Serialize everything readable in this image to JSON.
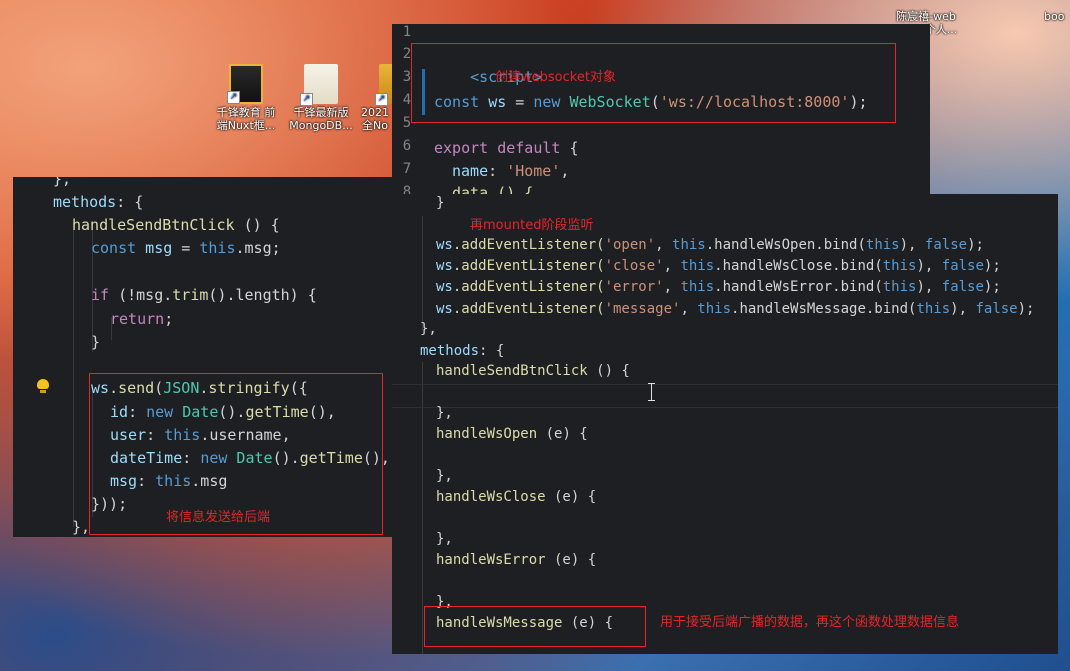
{
  "desktop": {
    "icons": [
      {
        "label": "千锋教育 前端Nuxt框...",
        "label1": "千锋教育 前",
        "label2": "端Nuxt框..."
      },
      {
        "label": "千锋最新版 MongoDB...",
        "label1": "千锋最新版",
        "label2": "MongoDB..."
      },
      {
        "label1": "2021",
        "label2": "全No"
      },
      {
        "label1": "陈宸禧-web",
        "label2": "个人..."
      },
      {
        "label1": "boo",
        "label2": ""
      }
    ]
  },
  "editor_top": {
    "line_numbers": [
      "1",
      "2",
      "3",
      "4",
      "5",
      "6",
      "7",
      "8"
    ],
    "lines": {
      "l2_tag": "<script>",
      "l4_const": "const",
      "l4_ws": "ws",
      "l4_eq": " = ",
      "l4_new": "new",
      "l4_cls": "WebSocket",
      "l4_open": "(",
      "l4_str": "'ws://localhost:8000'",
      "l4_close": ");",
      "l6_export": "export default",
      "l6_brace": " {",
      "l7_key": "name",
      "l7_colon": ": ",
      "l7_val": "'Home'",
      "l7_comma": ",",
      "l8_data": "data () {"
    },
    "note": "创建websocket对象"
  },
  "editor_left": {
    "lines": {
      "c0": "},",
      "c1_key": "methods",
      "c1_rest": ": {",
      "c2_fn": "handleSendBtnClick",
      "c2_rest": " () {",
      "c3_const": "const",
      "c3_var": " msg",
      "c3_eq": " = ",
      "c3_this": "this",
      "c3_rest": ".msg;",
      "c5_if": "if",
      "c5_a": " (!msg.",
      "c5_trim": "trim",
      "c5_b": "().length) {",
      "c6_ret": "return",
      "c6_semi": ";",
      "c7": "}",
      "c9_ws": "ws",
      "c9_dot": ".",
      "c9_send": "send",
      "c9_p": "(",
      "c9_json": "JSON",
      "c9_dot2": ".",
      "c9_str": "stringify",
      "c9_b": "({",
      "c10_key": "id",
      "c10_colon": ": ",
      "c10_new": "new",
      "c10_cls": " Date",
      "c10_rest": "().",
      "c10_fn": "getTime",
      "c10_end": "(),",
      "c11_key": "user",
      "c11_colon": ": ",
      "c11_this": "this",
      "c11_rest": ".username,",
      "c12_key": "dateTime",
      "c12_colon": ": ",
      "c12_new": "new",
      "c12_cls": " Date",
      "c12_rest": "().",
      "c12_fn": "getTime",
      "c12_end": "(),",
      "c13_key": "msg",
      "c13_colon": ": ",
      "c13_this": "this",
      "c13_rest": ".msg",
      "c14": "}));",
      "c15": "},"
    },
    "note": "将信息发送给后端"
  },
  "editor_right": {
    "lines": {
      "r0": "}",
      "r1_ws": "ws",
      "r1_m": ".addEventListener(",
      "r1_s": "'open'",
      "r1_c": ", ",
      "r1_this": "this",
      "r1_h": ".handleWsOpen.bind(",
      "r1_this2": "this",
      "r1_e": "), ",
      "r1_f": "false",
      "r1_end": ");",
      "r2_s": "'close'",
      "r2_h": ".handleWsClose.bind(",
      "r3_s": "'error'",
      "r3_h": ".handleWsError.bind(",
      "r4_s": "'message'",
      "r4_h": ".handleWsMessage.bind(",
      "r5": "},",
      "r6_key": "methods",
      "r6_rest": ": {",
      "r7_fn": "handleSendBtnClick",
      "r7_rest": " () {",
      "r9": "},",
      "r10_fn": "handleWsOpen",
      "r10_rest": " (e) {",
      "r11": "},",
      "r12_fn": "handleWsClose",
      "r12_rest": " (e) {",
      "r13": "},",
      "r14_fn": "handleWsError",
      "r14_rest": " (e) {",
      "r15": "},",
      "r16_fn": "handleWsMessage",
      "r16_rest": " (e) {"
    },
    "note_top": "再mounted阶段监听",
    "note_bottom": "用于接受后端广播的数据，再这个函数处理数据信息"
  },
  "colors": {
    "annotation": "#e3262a",
    "editor_bg": "#1e1f22"
  }
}
